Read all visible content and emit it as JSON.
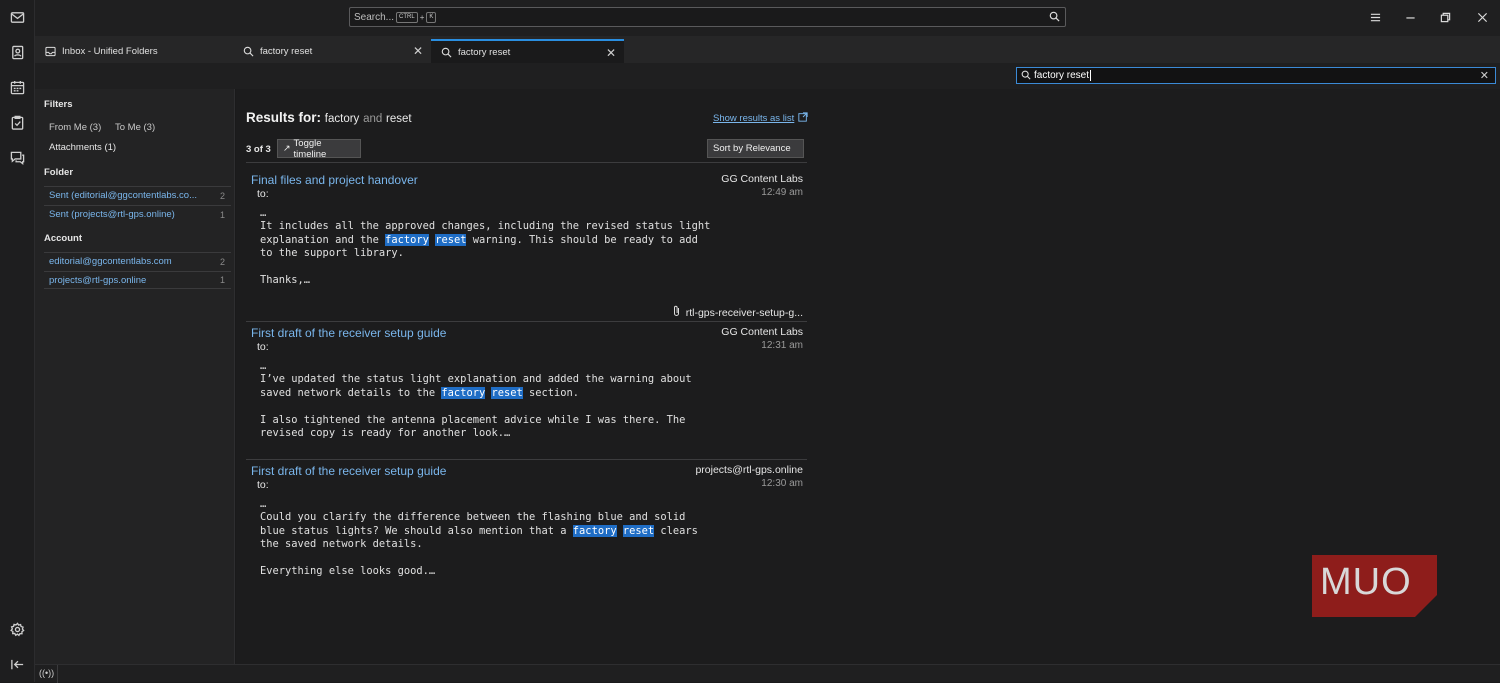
{
  "search": {
    "placeholder": "Search...",
    "kbd1": "CTRL",
    "kbd_plus": "+",
    "kbd2": "K"
  },
  "tabs": [
    {
      "label": "Inbox - Unified Folders",
      "icon": "inbox-icon"
    },
    {
      "label": "factory reset",
      "icon": "search-icon"
    },
    {
      "label": "factory reset",
      "icon": "search-icon"
    }
  ],
  "quick_search": {
    "value": "factory reset"
  },
  "filters": {
    "heading": "Filters",
    "from_me": "From Me  (3)",
    "to_me": "To Me  (3)",
    "attachments": "Attachments  (1)",
    "folder_heading": "Folder",
    "folders": [
      {
        "label": "Sent (editorial@ggcontentlabs.co...",
        "count": "2"
      },
      {
        "label": "Sent (projects@rtl-gps.online)",
        "count": "1"
      }
    ],
    "account_heading": "Account",
    "accounts": [
      {
        "label": "editorial@ggcontentlabs.com",
        "count": "2"
      },
      {
        "label": "projects@rtl-gps.online",
        "count": "1"
      }
    ]
  },
  "results": {
    "title_prefix": "Results for:",
    "term1": "factory",
    "and": "and",
    "term2": "reset",
    "show_list": "Show results as list",
    "count": "3 of 3",
    "toggle_timeline": "Toggle timeline",
    "sort": "Sort by Relevance",
    "messages": [
      {
        "subject": "Final files and project handover",
        "from": "GG Content Labs",
        "date": "12:49 am",
        "to": "to:",
        "ellipsis": "…",
        "line1": "It includes all the approved changes, including the revised status light",
        "line2_a": "explanation and the ",
        "line2_h1": "factory",
        "line2_h2": "reset",
        "line2_b": " warning. This should be ready to add",
        "line3": "to the support library.",
        "line5": "Thanks,…",
        "attachment": "rtl-gps-receiver-setup-g..."
      },
      {
        "subject": "First draft of the receiver setup guide",
        "from": "GG Content Labs",
        "date": "12:31 am",
        "to": "to:",
        "ellipsis": "…",
        "line1": "I’ve updated the status light explanation and added the warning about",
        "line2_a": "saved network details to the ",
        "line2_h1": "factory",
        "line2_h2": "reset",
        "line2_b": " section.",
        "line4": "I also tightened the antenna placement advice while I was there. The",
        "line5": "revised copy is ready for another look.…"
      },
      {
        "subject": "First draft of the receiver setup guide",
        "from": "projects@rtl-gps.online",
        "date": "12:30 am",
        "to": "to:",
        "ellipsis": "…",
        "line1": "Could you clarify the difference between the flashing blue and solid",
        "line2_a": "blue status lights? We should also mention that a ",
        "line2_h1": "factory",
        "line2_h2": "reset",
        "line2_b": " clears",
        "line3": "the saved network details.",
        "line5": "Everything else looks good.…"
      }
    ]
  },
  "watermark": {
    "text": "MUO"
  },
  "colors": {
    "accent": "#2a8ee0",
    "link": "#7ab6ec",
    "highlight": "#1f6dc5",
    "watermark": "#8e1d1b"
  }
}
